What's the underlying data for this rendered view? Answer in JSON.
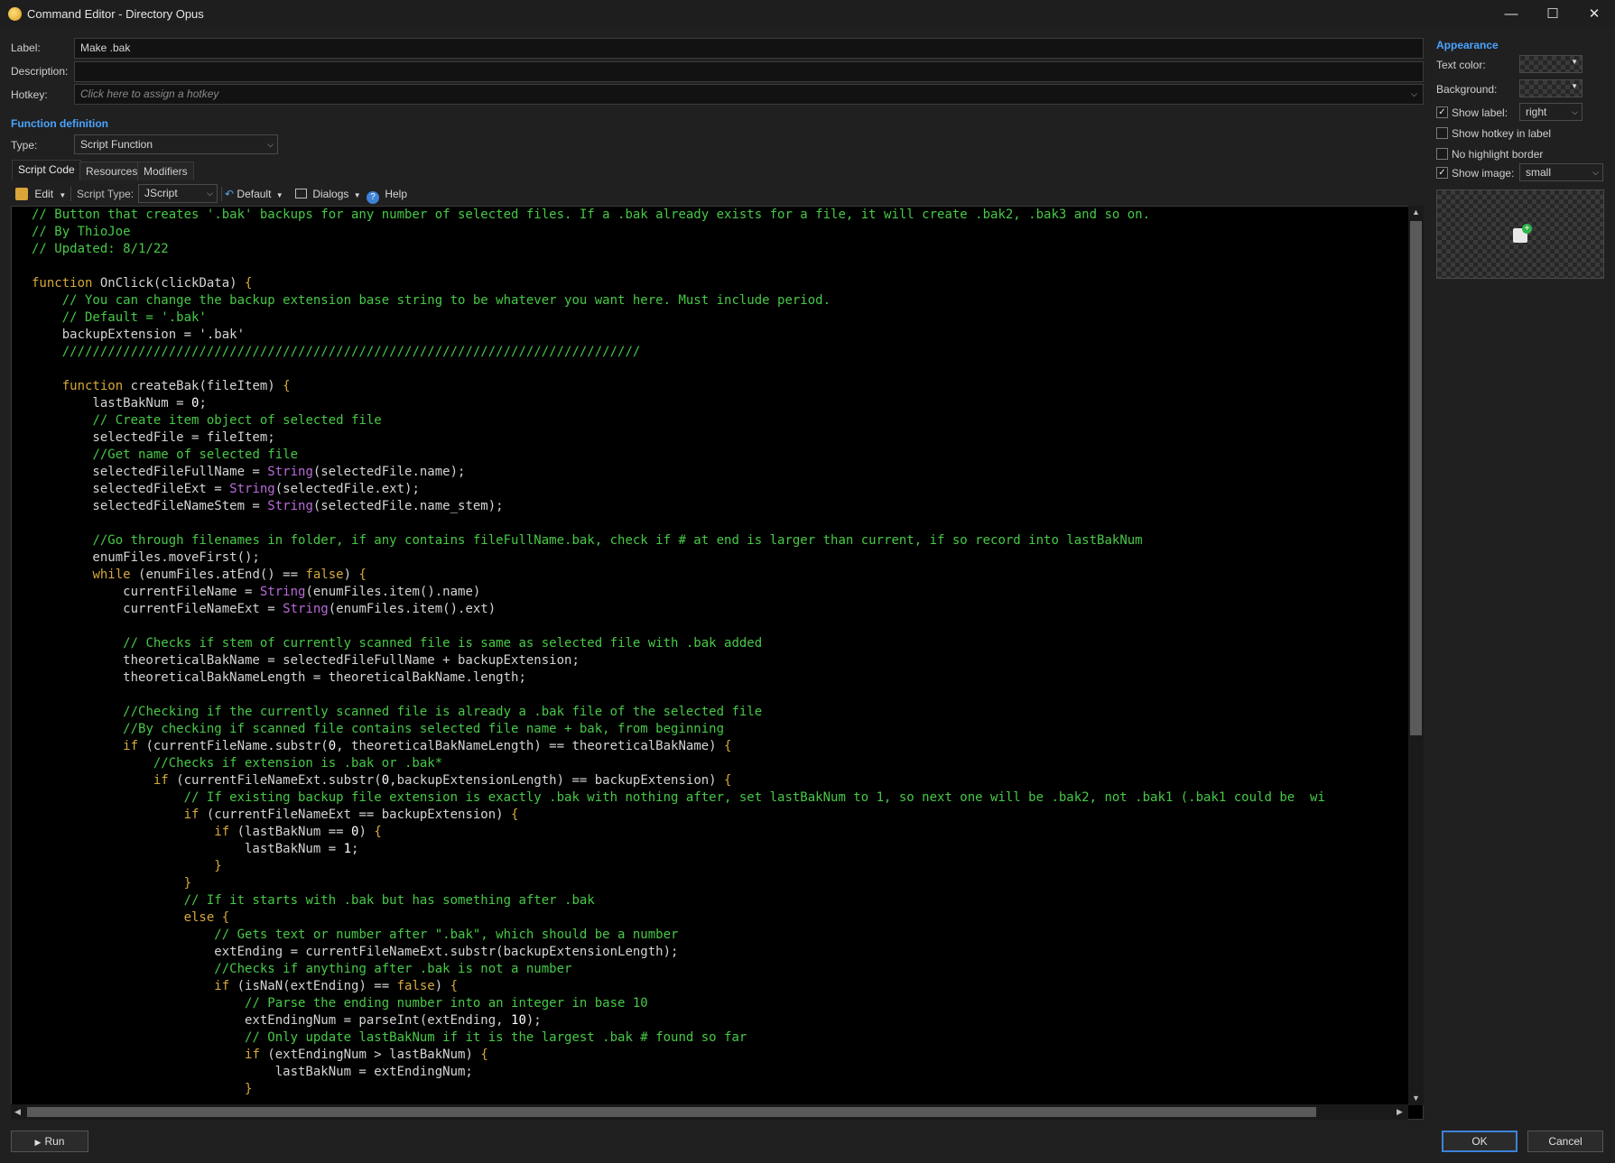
{
  "window": {
    "title": "Command Editor - Directory Opus",
    "minimize": "—",
    "maximize": "☐",
    "close": "✕"
  },
  "form": {
    "label_caption": "Label:",
    "label_value": "Make .bak",
    "description_caption": "Description:",
    "description_value": "",
    "hotkey_caption": "Hotkey:",
    "hotkey_placeholder": "Click here to assign a hotkey",
    "function_definition": "Function definition",
    "type_caption": "Type:",
    "type_value": "Script Function"
  },
  "tabs": [
    "Script Code",
    "Resources",
    "Modifiers"
  ],
  "toolbar": {
    "edit": "Edit",
    "script_type_caption": "Script Type:",
    "script_type_value": "JScript",
    "default": "Default",
    "dialogs": "Dialogs",
    "help": "Help"
  },
  "code_lines": [
    [
      [
        "com",
        "// Button that creates '.bak' backups for any number of selected files. If a .bak already exists for a file, it will create .bak2, .bak3 and so on."
      ]
    ],
    [
      [
        "com",
        "// By ThioJoe"
      ]
    ],
    [
      [
        "com",
        "// Updated: 8/1/22"
      ]
    ],
    [],
    [
      [
        "kw",
        "function"
      ],
      [
        "sym",
        " OnClick(clickData) "
      ],
      [
        "br",
        "{"
      ]
    ],
    [
      [
        "sym",
        "    "
      ],
      [
        "com",
        "// You can change the backup extension base string to be whatever you want here. Must include period."
      ]
    ],
    [
      [
        "sym",
        "    "
      ],
      [
        "com",
        "// Default = '.bak'"
      ]
    ],
    [
      [
        "sym",
        "    backupExtension = '.bak'"
      ]
    ],
    [
      [
        "sym",
        "    "
      ],
      [
        "com",
        "////////////////////////////////////////////////////////////////////////////"
      ]
    ],
    [],
    [
      [
        "sym",
        "    "
      ],
      [
        "kw",
        "function"
      ],
      [
        "sym",
        " createBak(fileItem) "
      ],
      [
        "br",
        "{"
      ]
    ],
    [
      [
        "sym",
        "        lastBakNum = "
      ],
      [
        "num",
        "0"
      ],
      [
        "sym",
        ";"
      ]
    ],
    [
      [
        "sym",
        "        "
      ],
      [
        "com",
        "// Create item object of selected file"
      ]
    ],
    [
      [
        "sym",
        "        selectedFile = fileItem;"
      ]
    ],
    [
      [
        "sym",
        "        "
      ],
      [
        "com",
        "//Get name of selected file"
      ]
    ],
    [
      [
        "sym",
        "        selectedFileFullName = "
      ],
      [
        "fn",
        "String"
      ],
      [
        "sym",
        "(selectedFile.name);"
      ]
    ],
    [
      [
        "sym",
        "        selectedFileExt = "
      ],
      [
        "fn",
        "String"
      ],
      [
        "sym",
        "(selectedFile.ext);"
      ]
    ],
    [
      [
        "sym",
        "        selectedFileNameStem = "
      ],
      [
        "fn",
        "String"
      ],
      [
        "sym",
        "(selectedFile.name_stem);"
      ]
    ],
    [],
    [
      [
        "sym",
        "        "
      ],
      [
        "com",
        "//Go through filenames in folder, if any contains fileFullName.bak, check if # at end is larger than current, if so record into lastBakNum"
      ]
    ],
    [
      [
        "sym",
        "        enumFiles.moveFirst();"
      ]
    ],
    [
      [
        "sym",
        "        "
      ],
      [
        "kw",
        "while"
      ],
      [
        "sym",
        " (enumFiles.atEnd() == "
      ],
      [
        "kw",
        "false"
      ],
      [
        "sym",
        ") "
      ],
      [
        "br",
        "{"
      ]
    ],
    [
      [
        "sym",
        "            currentFileName = "
      ],
      [
        "fn",
        "String"
      ],
      [
        "sym",
        "(enumFiles.item().name)"
      ]
    ],
    [
      [
        "sym",
        "            currentFileNameExt = "
      ],
      [
        "fn",
        "String"
      ],
      [
        "sym",
        "(enumFiles.item().ext)"
      ]
    ],
    [],
    [
      [
        "sym",
        "            "
      ],
      [
        "com",
        "// Checks if stem of currently scanned file is same as selected file with .bak added"
      ]
    ],
    [
      [
        "sym",
        "            theoreticalBakName = selectedFileFullName + backupExtension;"
      ]
    ],
    [
      [
        "sym",
        "            theoreticalBakNameLength = theoreticalBakName.length;"
      ]
    ],
    [],
    [
      [
        "sym",
        "            "
      ],
      [
        "com",
        "//Checking if the currently scanned file is already a .bak file of the selected file"
      ]
    ],
    [
      [
        "sym",
        "            "
      ],
      [
        "com",
        "//By checking if scanned file contains selected file name + bak, from beginning"
      ]
    ],
    [
      [
        "sym",
        "            "
      ],
      [
        "kw",
        "if"
      ],
      [
        "sym",
        " (currentFileName.substr("
      ],
      [
        "num",
        "0"
      ],
      [
        "sym",
        ", theoreticalBakNameLength) == theoreticalBakName) "
      ],
      [
        "br",
        "{"
      ]
    ],
    [
      [
        "sym",
        "                "
      ],
      [
        "com",
        "//Checks if extension is .bak or .bak*"
      ]
    ],
    [
      [
        "sym",
        "                "
      ],
      [
        "kw",
        "if"
      ],
      [
        "sym",
        " (currentFileNameExt.substr("
      ],
      [
        "num",
        "0"
      ],
      [
        "sym",
        ",backupExtensionLength) == backupExtension) "
      ],
      [
        "br",
        "{"
      ]
    ],
    [
      [
        "sym",
        "                    "
      ],
      [
        "com",
        "// If existing backup file extension is exactly .bak with nothing after, set lastBakNum to 1, so next one will be .bak2, not .bak1 (.bak1 could be  wi"
      ]
    ],
    [
      [
        "sym",
        "                    "
      ],
      [
        "kw",
        "if"
      ],
      [
        "sym",
        " (currentFileNameExt == backupExtension) "
      ],
      [
        "br",
        "{"
      ]
    ],
    [
      [
        "sym",
        "                        "
      ],
      [
        "kw",
        "if"
      ],
      [
        "sym",
        " (lastBakNum == "
      ],
      [
        "num",
        "0"
      ],
      [
        "sym",
        ") "
      ],
      [
        "br",
        "{"
      ]
    ],
    [
      [
        "sym",
        "                            lastBakNum = "
      ],
      [
        "num",
        "1"
      ],
      [
        "sym",
        ";"
      ]
    ],
    [
      [
        "sym",
        "                        "
      ],
      [
        "br",
        "}"
      ]
    ],
    [
      [
        "sym",
        "                    "
      ],
      [
        "br",
        "}"
      ]
    ],
    [
      [
        "sym",
        "                    "
      ],
      [
        "com",
        "// If it starts with .bak but has something after .bak"
      ]
    ],
    [
      [
        "sym",
        "                    "
      ],
      [
        "kw",
        "else"
      ],
      [
        "sym",
        " "
      ],
      [
        "br",
        "{"
      ]
    ],
    [
      [
        "sym",
        "                        "
      ],
      [
        "com",
        "// Gets text or number after \".bak\", which should be a number"
      ]
    ],
    [
      [
        "sym",
        "                        extEnding = currentFileNameExt.substr(backupExtensionLength);"
      ]
    ],
    [
      [
        "sym",
        "                        "
      ],
      [
        "com",
        "//Checks if anything after .bak is not a number"
      ]
    ],
    [
      [
        "sym",
        "                        "
      ],
      [
        "kw",
        "if"
      ],
      [
        "sym",
        " (isNaN(extEnding) == "
      ],
      [
        "kw",
        "false"
      ],
      [
        "sym",
        ") "
      ],
      [
        "br",
        "{"
      ]
    ],
    [
      [
        "sym",
        "                            "
      ],
      [
        "com",
        "// Parse the ending number into an integer in base 10"
      ]
    ],
    [
      [
        "sym",
        "                            extEndingNum = parseInt(extEnding, "
      ],
      [
        "num",
        "10"
      ],
      [
        "sym",
        ");"
      ]
    ],
    [
      [
        "sym",
        "                            "
      ],
      [
        "com",
        "// Only update lastBakNum if it is the largest .bak # found so far"
      ]
    ],
    [
      [
        "sym",
        "                            "
      ],
      [
        "kw",
        "if"
      ],
      [
        "sym",
        " (extEndingNum > lastBakNum) "
      ],
      [
        "br",
        "{"
      ]
    ],
    [
      [
        "sym",
        "                                lastBakNum = extEndingNum;"
      ]
    ],
    [
      [
        "sym",
        "                            "
      ],
      [
        "br",
        "}"
      ]
    ]
  ],
  "appearance": {
    "title": "Appearance",
    "text_color": "Text color:",
    "background": "Background:",
    "show_label": "Show label:",
    "show_label_value": "right",
    "show_label_checked": "✓",
    "show_hotkey": "Show hotkey in label",
    "no_highlight": "No highlight border",
    "show_image": "Show image:",
    "show_image_value": "small",
    "show_image_checked": "✓"
  },
  "buttons": {
    "run": "Run",
    "ok": "OK",
    "cancel": "Cancel"
  },
  "colors": {
    "comment": "#47c947",
    "keyword": "#d6a93a",
    "builtin": "#b96ad9",
    "accent": "#4aa3ff"
  }
}
